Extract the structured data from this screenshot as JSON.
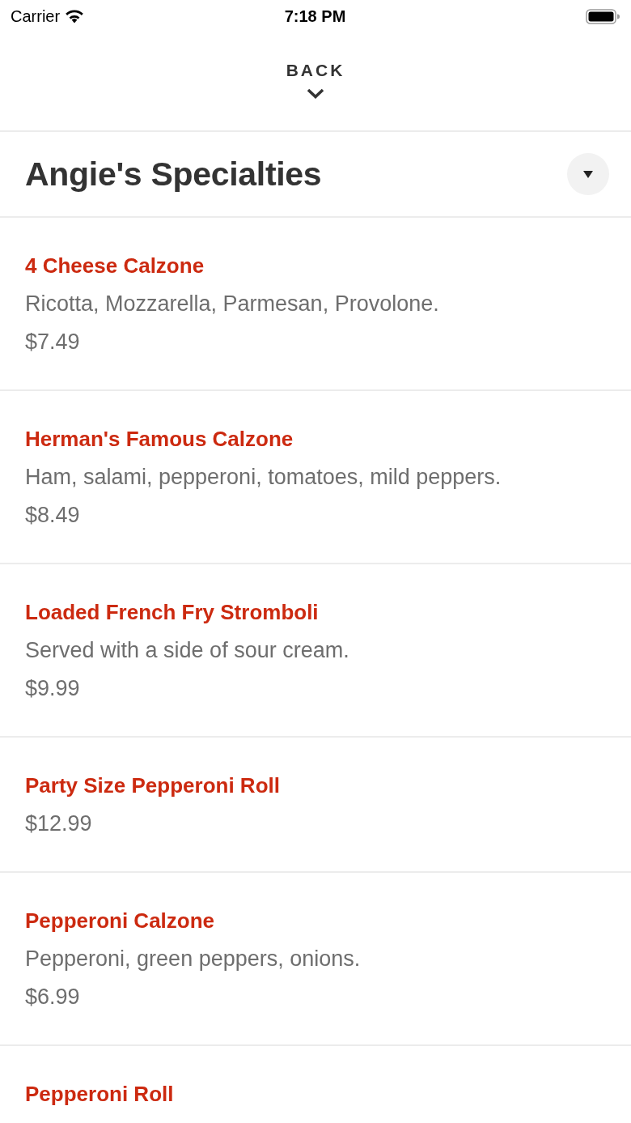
{
  "status_bar": {
    "carrier": "Carrier",
    "time": "7:18 PM"
  },
  "nav": {
    "back_label": "BACK"
  },
  "category": {
    "title": "Angie's Specialties"
  },
  "items": [
    {
      "name": "4 Cheese Calzone",
      "description": "Ricotta, Mozzarella, Parmesan, Provolone.",
      "price": "$7.49"
    },
    {
      "name": "Herman's Famous Calzone",
      "description": "Ham, salami, pepperoni, tomatoes, mild peppers.",
      "price": "$8.49"
    },
    {
      "name": "Loaded French Fry Stromboli",
      "description": "Served with a side of sour cream.",
      "price": "$9.99"
    },
    {
      "name": "Party Size Pepperoni Roll",
      "price": "$12.99"
    },
    {
      "name": "Pepperoni Calzone",
      "description": "Pepperoni, green peppers, onions.",
      "price": "$6.99"
    },
    {
      "name": "Pepperoni Roll"
    }
  ]
}
